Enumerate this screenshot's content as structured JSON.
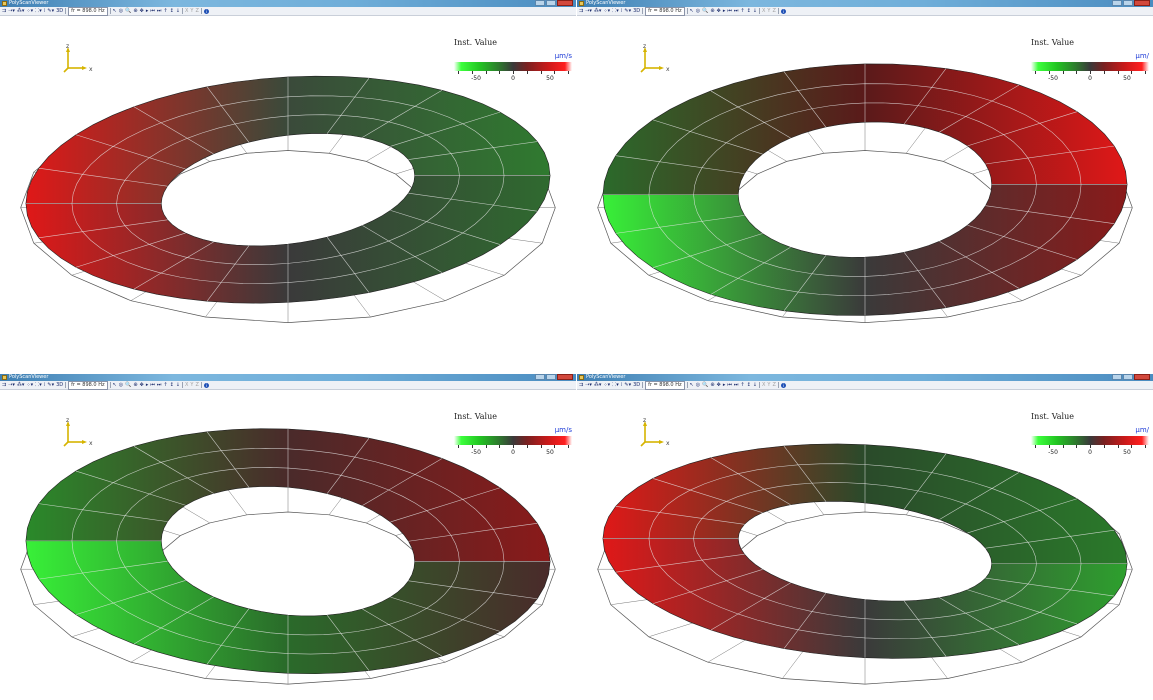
{
  "app": {
    "title": "PolyScanViewer",
    "toolbar": {
      "items": [
        "⇉",
        "⇢▾",
        "⁂▾",
        "⁘▾",
        "⸬▾",
        "⁞",
        "✎▾",
        "3D"
      ],
      "freq_combo": "fr = 898.0 Hz",
      "nav_items": [
        "↖",
        "◎",
        "🔍",
        "⊕",
        "✥",
        "▸",
        "⏮",
        "⏭",
        "↑",
        "↕",
        "↓"
      ],
      "axis_items": [
        "X",
        "Y",
        "Z"
      ],
      "info": "i"
    }
  },
  "panes": [
    {
      "legend_title": "Inst. Value",
      "legend_unit": "μm/s",
      "legend_labels": [
        "-50",
        "0",
        "50"
      ],
      "axis_z": "z",
      "axis_x": "x",
      "colors": {
        "top_left": "#e01818",
        "top_mid": "#3a4a3a",
        "top_right": "#2f7a2f",
        "bottom_left": "#e01818",
        "bottom_mid": "#3a3a3a",
        "bottom_right": "#2f6a2f"
      }
    },
    {
      "legend_title": "Inst. Value",
      "legend_unit": "μm/",
      "legend_labels": [
        "-50",
        "0",
        "50"
      ],
      "axis_z": "z",
      "axis_x": "x",
      "colors": {
        "top_left": "#2b6a2b",
        "top_mid": "#5a1a1a",
        "top_right": "#e01818",
        "bottom_left": "#38f038",
        "bottom_mid": "#3a3a3a",
        "bottom_right": "#8a1a1a"
      }
    },
    {
      "legend_title": "Inst. Value",
      "legend_unit": "μm/s",
      "legend_labels": [
        "-50",
        "0",
        "50"
      ],
      "axis_z": "z",
      "axis_x": "x",
      "colors": {
        "top_left": "#2a8a2a",
        "top_mid": "#4a2a2a",
        "top_right": "#8a1a1a",
        "bottom_left": "#38f038",
        "bottom_mid": "#2a6a2a",
        "bottom_right": "#4a2a2a"
      }
    },
    {
      "legend_title": "Inst. Value",
      "legend_unit": "μm/",
      "legend_labels": [
        "-50",
        "0",
        "50"
      ],
      "axis_z": "z",
      "axis_x": "x",
      "colors": {
        "top_left": "#e01818",
        "top_mid": "#2a4a2a",
        "top_right": "#2a7a2a",
        "bottom_left": "#e01818",
        "bottom_mid": "#3a3a3a",
        "bottom_right": "#2ea02e"
      }
    }
  ]
}
